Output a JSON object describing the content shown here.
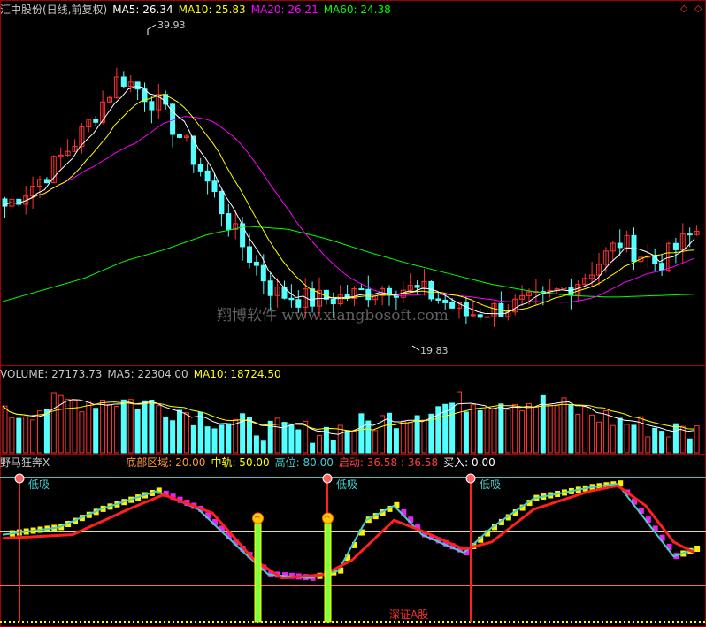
{
  "price_panel": {
    "stock_name": "汇中股份(日线,前复权)",
    "ma5": "MA5: 26.34",
    "ma10": "MA10: 25.83",
    "ma20": "MA20: 26.21",
    "ma60": "MA60: 24.38",
    "high_label": "39.93",
    "low_label": "19.83",
    "watermark": "翔博软件 www.xiangbosoft.com",
    "colors": {
      "ma5": "#ffffff",
      "ma10": "#ffff00",
      "ma20": "#ff00ff",
      "ma60": "#00ff00",
      "up": "#ff3232",
      "down": "#54ffff"
    }
  },
  "volume_panel": {
    "volume": "VOLUME: 27173.73",
    "ma5": "MA5: 22304.00",
    "ma10": "MA10: 18724.50"
  },
  "indicator_panel": {
    "name": "野马狂奔X",
    "bottom_zone": "底部区域: 20.00",
    "mid_rail": "中轨: 50.00",
    "high_level": "高位: 80.00",
    "start": "启动: 36.58 : 36.58",
    "buy": "买入: 0.00",
    "buy_signal_label": "低吸",
    "footer_label": "深证A股"
  },
  "chart_data": [
    {
      "type": "candlestick",
      "title": "汇中股份(日线,前复权)",
      "series": [
        "MA5",
        "MA10",
        "MA20",
        "MA60"
      ],
      "annotations": [
        "39.93",
        "19.83"
      ],
      "ma60_approx": [
        21.4,
        22.2,
        23.0,
        24.2,
        25.0,
        26.0,
        26.6,
        26.4,
        25.7,
        24.8,
        24.0,
        23.3,
        22.6,
        22.1,
        21.8,
        21.7,
        21.8,
        21.9
      ],
      "close_approx": [
        28.0,
        30.0,
        33.0,
        37.0,
        35.0,
        31.0,
        26.0,
        22.0,
        21.5,
        21.8,
        22.5,
        22.0,
        20.5,
        21.0,
        21.5,
        23.0,
        25.5,
        24.0,
        26.3
      ]
    },
    {
      "type": "bar",
      "title": "VOLUME",
      "series": [
        "VOLUME",
        "MA5",
        "MA10"
      ],
      "last_values": {
        "VOLUME": 27173.73,
        "MA5": 22304.0,
        "MA10": 18724.5
      }
    },
    {
      "type": "line",
      "title": "野马狂奔X",
      "levels": {
        "底部区域": 20,
        "中轨": 50,
        "高位": 80
      },
      "values": {
        "启动": 36.58,
        "买入": 0.0
      }
    }
  ]
}
